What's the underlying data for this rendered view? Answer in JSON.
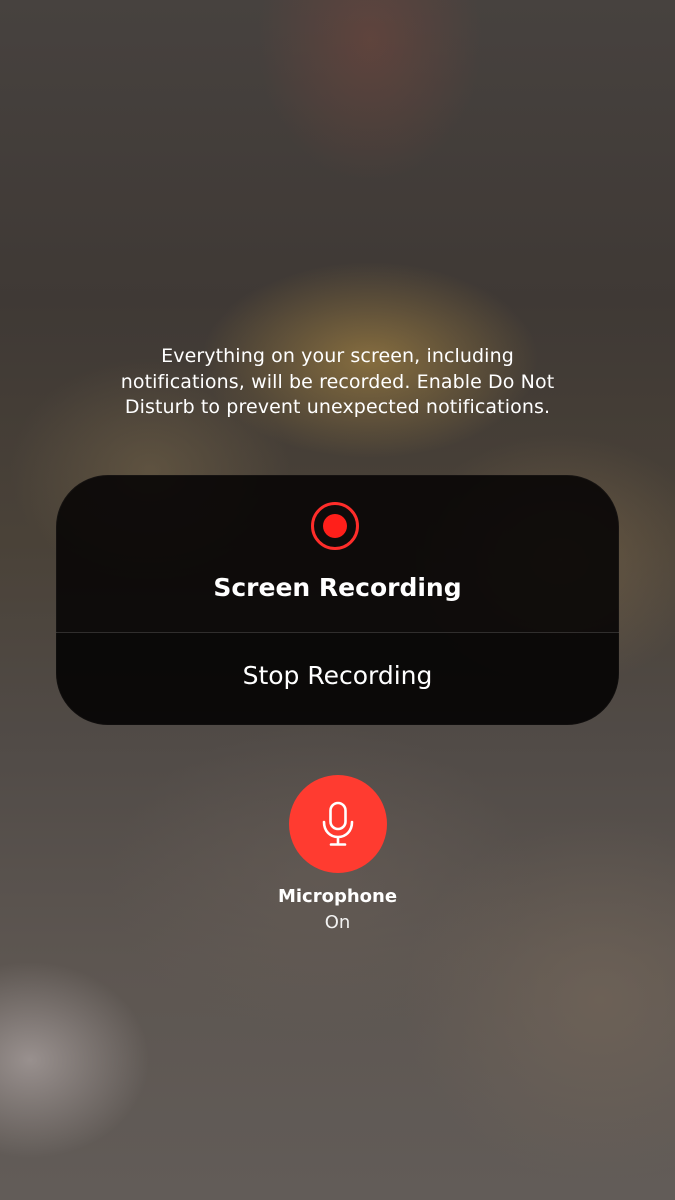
{
  "screen_recording_sheet": {
    "warning": "Everything on your screen, including\nnotifications, will be recorded. Enable Do Not\nDisturb to prevent unexpected notifications.",
    "panel": {
      "title": "Screen Recording",
      "indicator_icon": "record-icon",
      "stop_button_label": "Stop Recording"
    },
    "microphone": {
      "icon": "microphone-icon",
      "label": "Microphone",
      "status": "On"
    }
  },
  "colors": {
    "record_red": "#ff1f1a",
    "microphone_active": "#ff3b30",
    "panel_background": "#080605",
    "text": "#ffffff"
  }
}
